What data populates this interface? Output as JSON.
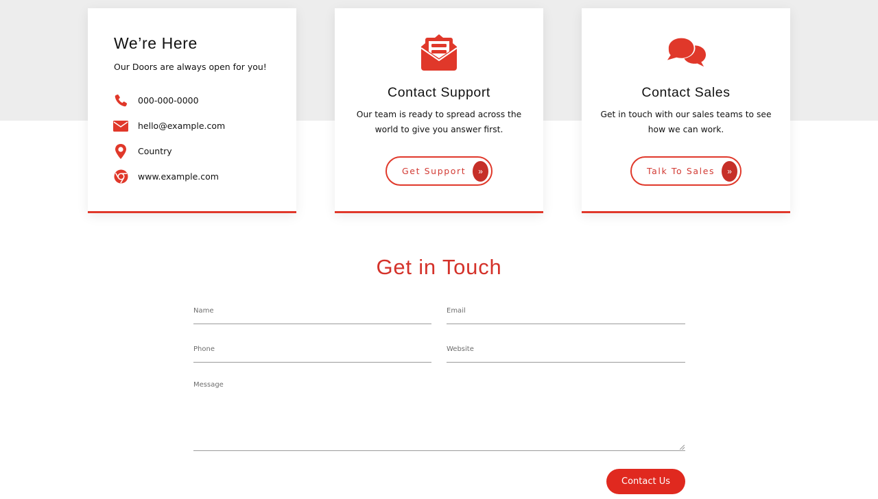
{
  "colors": {
    "accent": "#e0382a",
    "button": "#e0291f",
    "heading_accent": "#d4322a",
    "band": "#ededed"
  },
  "info_card": {
    "title": "We’re Here",
    "subtitle": "Our Doors are always open for you!",
    "items": [
      {
        "icon": "phone-icon",
        "text": "000-000-0000"
      },
      {
        "icon": "envelope-icon",
        "text": "hello@example.com"
      },
      {
        "icon": "map-pin-icon",
        "text": "Country"
      },
      {
        "icon": "chrome-icon",
        "text": "www.example.com"
      }
    ]
  },
  "support_card": {
    "icon": "open-envelope-icon",
    "title": "Contact Support",
    "description": "Our team is ready to spread across the world to give you answer first.",
    "button_label": "Get Support",
    "button_icon": "»"
  },
  "sales_card": {
    "icon": "chat-bubbles-icon",
    "title": "Contact Sales",
    "description": "Get in touch with our sales teams to see how we can work.",
    "button_label": "Talk To Sales",
    "button_icon": "»"
  },
  "form": {
    "title": "Get in Touch",
    "fields": {
      "name": {
        "placeholder": "Name",
        "value": ""
      },
      "email": {
        "placeholder": "Email",
        "value": ""
      },
      "phone": {
        "placeholder": "Phone",
        "value": ""
      },
      "website": {
        "placeholder": "Website",
        "value": ""
      },
      "message": {
        "placeholder": "Message",
        "value": ""
      }
    },
    "submit_label": "Contact Us"
  }
}
